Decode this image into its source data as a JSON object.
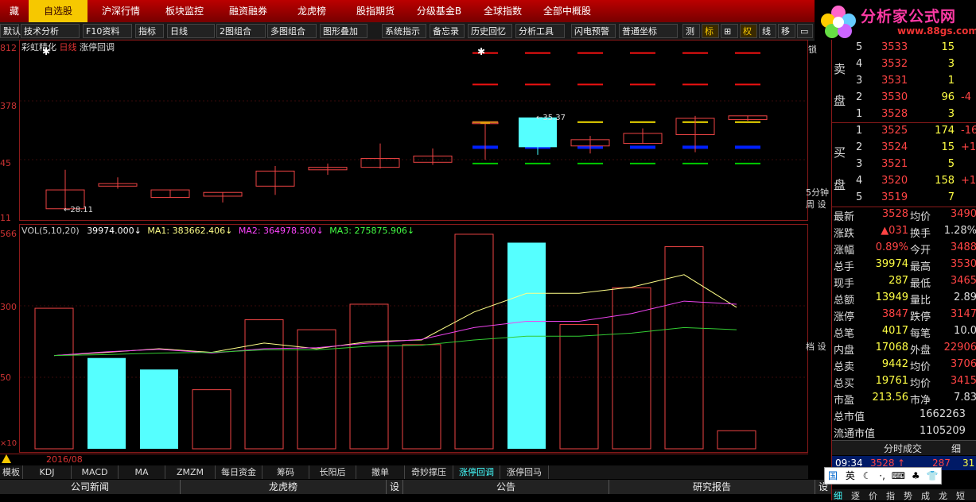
{
  "top_tabs": [
    {
      "label": "藏"
    },
    {
      "label": "自选股"
    },
    {
      "label": "沪深行情"
    },
    {
      "label": "板块监控"
    },
    {
      "label": "融资融券"
    },
    {
      "label": "龙虎榜"
    },
    {
      "label": "股指期货"
    },
    {
      "label": "分级基金B"
    },
    {
      "label": "全球指数"
    },
    {
      "label": "全部中概股"
    }
  ],
  "logo": {
    "text": "分析家公式网",
    "url": "www.88gs.com"
  },
  "toolbar": [
    "默认",
    "技术分析",
    "F10资料",
    "指标",
    "日线",
    "2图组合",
    "多图组合",
    "图形叠加",
    "系统指示",
    "备忘录",
    "历史回忆",
    "分析工具",
    "闪电预警",
    "普通坐标",
    "测",
    "标",
    "权",
    "线",
    "移"
  ],
  "chart_title": {
    "name": "彩虹精化",
    "period": "日线",
    "indicator": "涨停回调"
  },
  "price_axis": [
    "812",
    "378",
    "45",
    "11"
  ],
  "vol_axis": [
    "566",
    "300",
    "50"
  ],
  "ann_high": "35.37",
  "ann_low": "28.11",
  "vol_legend": {
    "vol": "VOL(5,10,20)",
    "vol_val": "39974.000↓",
    "ma1": "MA1: 383662.406↓",
    "ma2": "MA2: 364978.500↓",
    "ma3": "MA3: 275875.906↓"
  },
  "date_label": "2016/08",
  "side_labels": {
    "lock": "锁",
    "period5": "5分钟",
    "set1": "周 设",
    "set2": "档 设",
    "x10": "×10"
  },
  "chart_data": {
    "type": "candlestick",
    "candles": [
      {
        "o": 29.6,
        "h": 31.2,
        "l": 28.1,
        "c": 28.1
      },
      {
        "o": 29.9,
        "h": 30.6,
        "l": 29.7,
        "c": 30.1
      },
      {
        "o": 29.0,
        "h": 29.6,
        "l": 29.0,
        "c": 29.6
      },
      {
        "o": 29.1,
        "h": 29.4,
        "l": 28.6,
        "c": 29.4
      },
      {
        "o": 29.9,
        "h": 31.5,
        "l": 29.2,
        "c": 31.1
      },
      {
        "o": 31.2,
        "h": 31.7,
        "l": 30.8,
        "c": 31.4
      },
      {
        "o": 31.4,
        "h": 33.3,
        "l": 31.3,
        "c": 32.1
      },
      {
        "o": 31.8,
        "h": 32.9,
        "l": 31.6,
        "c": 32.3
      },
      {
        "o": 35.0,
        "h": 35.0,
        "l": 32.0,
        "c": 35.0,
        "up": true
      },
      {
        "o": 35.37,
        "h": 35.37,
        "l": 32.4,
        "c": 33.0,
        "cyan": true
      },
      {
        "o": 33.1,
        "h": 33.9,
        "l": 32.5,
        "c": 33.6
      },
      {
        "o": 34.1,
        "h": 34.5,
        "l": 33.3,
        "c": 33.3
      },
      {
        "o": 35.3,
        "h": 35.5,
        "l": 32.6,
        "c": 34.0
      },
      {
        "o": 35.2,
        "h": 35.5,
        "l": 35.1,
        "c": 35.5
      }
    ],
    "volumes": [
      452,
      292,
      255,
      190,
      415,
      383,
      465,
      335,
      690,
      663,
      400,
      518,
      650,
      58
    ],
    "vol_up": [
      false,
      true,
      true,
      false,
      false,
      false,
      false,
      false,
      false,
      true,
      false,
      false,
      false,
      false
    ],
    "ma1": [
      300,
      310,
      322,
      310,
      340,
      322,
      345,
      350,
      440,
      500,
      500,
      520,
      560,
      455
    ],
    "ma2": [
      300,
      312,
      320,
      308,
      322,
      325,
      340,
      352,
      390,
      410,
      410,
      435,
      475,
      465
    ],
    "ma3": [
      300,
      303,
      308,
      310,
      318,
      318,
      330,
      333,
      350,
      362,
      362,
      372,
      390,
      383
    ],
    "levels": {
      "top_red": 40.5,
      "red2": 38.0,
      "yellow": 35.0,
      "blue": 33.0,
      "green": 31.7
    }
  },
  "quote": {
    "sell": [
      {
        "n": "5",
        "p": "3533",
        "v": "15",
        "d": ""
      },
      {
        "n": "4",
        "p": "3532",
        "v": "3",
        "d": ""
      },
      {
        "n": "3",
        "p": "3531",
        "v": "1",
        "d": ""
      },
      {
        "n": "2",
        "p": "3530",
        "v": "96",
        "d": "-4"
      },
      {
        "n": "1",
        "p": "3528",
        "v": "3",
        "d": ""
      }
    ],
    "buy": [
      {
        "n": "1",
        "p": "3525",
        "v": "174",
        "d": "-169"
      },
      {
        "n": "2",
        "p": "3524",
        "v": "15",
        "d": "+12"
      },
      {
        "n": "3",
        "p": "3521",
        "v": "5",
        "d": ""
      },
      {
        "n": "4",
        "p": "3520",
        "v": "158",
        "d": "+113"
      },
      {
        "n": "5",
        "p": "3519",
        "v": "7",
        "d": ""
      }
    ],
    "sell_label": [
      "卖",
      "盘"
    ],
    "buy_label": [
      "买",
      "盘"
    ],
    "stats": [
      [
        "最新",
        "3528",
        "均价",
        "3490"
      ],
      [
        "涨跌",
        "▲031",
        "换手",
        "1.28%"
      ],
      [
        "涨幅",
        "0.89%",
        "今开",
        "3488"
      ],
      [
        "总手",
        "39974",
        "最高",
        "3530"
      ],
      [
        "现手",
        "287",
        "最低",
        "3465"
      ],
      [
        "总额",
        "13949",
        "量比",
        "2.89"
      ],
      [
        "涨停",
        "3847",
        "跌停",
        "3147"
      ],
      [
        "总笔",
        "4017",
        "每笔",
        "10.0"
      ],
      [
        "内盘",
        "17068",
        "外盘",
        "22906"
      ],
      [
        "总卖",
        "9442",
        "均价",
        "3706"
      ],
      [
        "总买",
        "19761",
        "均价",
        "3415"
      ],
      [
        "市盈",
        "213.56",
        "市净",
        "7.83"
      ]
    ],
    "cap": [
      [
        "总市值",
        "1662263"
      ],
      [
        "流通市值",
        "1105209"
      ]
    ],
    "tick_title": "分时成交",
    "tick_btn": "细",
    "tick": {
      "time": "09:34",
      "price": "3528",
      "arrow": "↑",
      "vol": "287",
      "n": "31"
    }
  },
  "bottom_tabs": [
    "模板",
    "KDJ",
    "MACD",
    "MA",
    "ZMZM",
    "每日资金",
    "筹码",
    "长阳后",
    "撤单",
    "奇妙撑压",
    "涨停回调",
    "涨停回马"
  ],
  "news_tabs": [
    "公司新闻",
    "龙虎榜",
    "设",
    "公告",
    "研究报告",
    "设"
  ],
  "ime": [
    "国",
    "英",
    "☾",
    "·,",
    "⌨",
    "♣",
    "👕",
    "⚙"
  ],
  "right_bottom_tabs": [
    "细",
    "逐",
    "价",
    "指",
    "势",
    "成",
    "龙",
    "短"
  ],
  "colors": {
    "up": "#ff4040",
    "down": "#40ffff",
    "bg": "#000000",
    "grid": "#8b1a1a",
    "yellow": "#f6c800",
    "blue": "#0000ff",
    "green": "#00d000"
  }
}
